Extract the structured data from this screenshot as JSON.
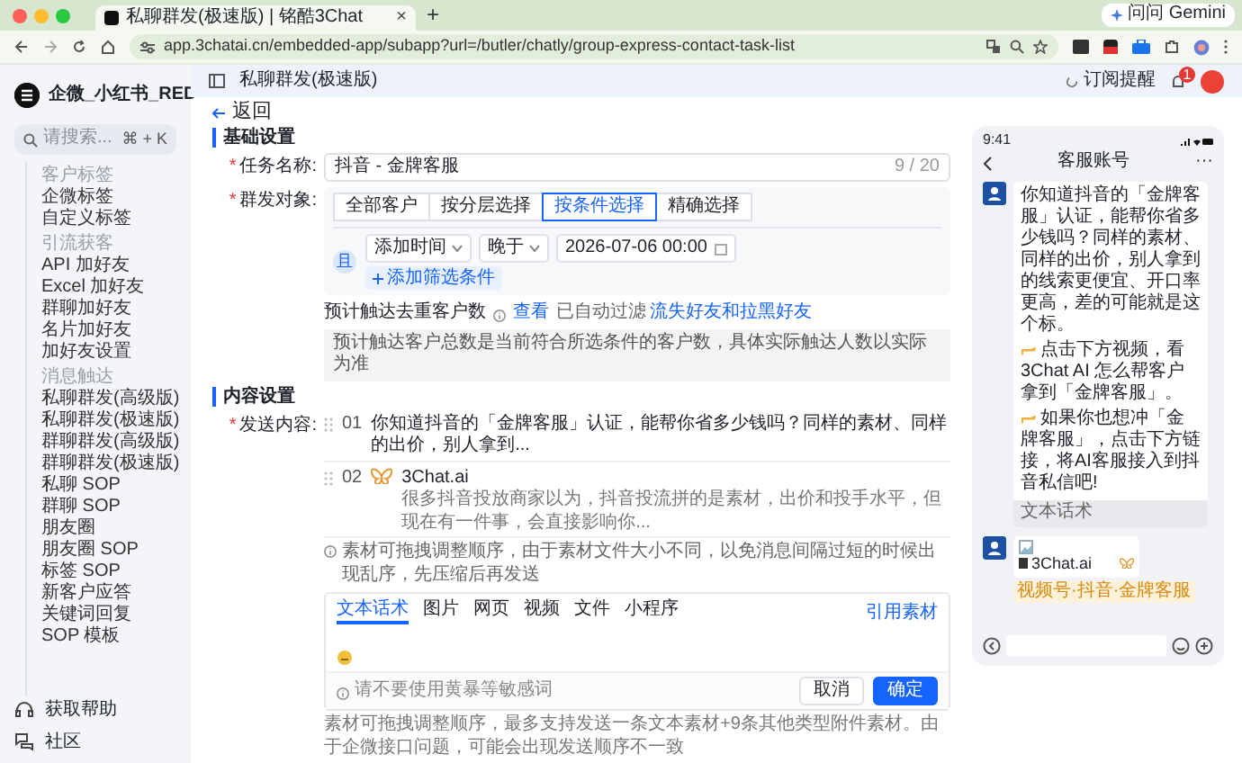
{
  "browser": {
    "tab_title": "私聊群发(极速版) | 铭酷3Chat",
    "tab_close": "×",
    "new_tab": "+",
    "url": "app.3chatai.cn/embedded-app/subapp?url=/butler/chatly/group-express-contact-task-list",
    "gemini": "问问 Gemini"
  },
  "sidebar": {
    "brand": "企微_小红书_RED",
    "search": {
      "placeholder": "请搜索...",
      "shortcut": "⌘ + K"
    },
    "sections": [
      {
        "title": "客户标签",
        "items": [
          "企微标签",
          "自定义标签"
        ]
      },
      {
        "title": "引流获客",
        "items": [
          "API 加好友",
          "Excel 加好友",
          "群聊加好友",
          "名片加好友",
          "加好友设置"
        ]
      },
      {
        "title": "消息触达",
        "items": [
          "私聊群发(高级版)",
          "私聊群发(极速版)",
          "群聊群发(高级版)",
          "群聊群发(极速版)",
          "私聊 SOP",
          "群聊 SOP",
          "朋友圈",
          "朋友圈 SOP",
          "标签 SOP",
          "新客户应答",
          "关键词回复",
          "SOP 模板"
        ]
      }
    ],
    "footer": [
      {
        "kind": "help",
        "label": "获取帮助"
      },
      {
        "kind": "community",
        "label": "社区"
      }
    ]
  },
  "topbar": {
    "title": "私聊群发(极速版)",
    "subscribe": "订阅提醒",
    "notification_count": "1"
  },
  "back": "返回",
  "basic": {
    "title": "基础设置",
    "task_name": {
      "required_mark": "*",
      "label": "任务名称:",
      "value": "抖音 - 金牌客服",
      "counter": "9 / 20"
    },
    "audience": {
      "required_mark": "*",
      "label": "群发对象:",
      "tabs": [
        {
          "label": "全部客户",
          "selected": false
        },
        {
          "label": "按分层选择",
          "selected": false
        },
        {
          "label": "按条件选择",
          "selected": true
        },
        {
          "label": "精确选择",
          "selected": false
        }
      ],
      "logic": "且",
      "conditions": [
        {
          "field": "添加时间",
          "operator": "晚于",
          "value": "2026-07-06 00:00"
        }
      ],
      "add_filter": "添加筛选条件"
    },
    "estimate": {
      "label": "预计触达去重客户数",
      "link": "查看",
      "note_prefix": "已自动过滤",
      "note_highlight": "流失好友和拉黑好友"
    },
    "info": "预计触达客户总数是当前符合所选条件的客户数，具体实际触达人数以实际为准"
  },
  "content": {
    "title": "内容设置",
    "required_mark": "*",
    "label": "发送内容:",
    "items": [
      {
        "kind": "text",
        "index": "01",
        "text": "你知道抖音的「金牌客服」认证，能帮你省多少钱吗？同样的素材、同样的出价，别人拿到..."
      },
      {
        "kind": "link",
        "index": "02",
        "title": "3Chat.ai",
        "description": "很多抖音投放商家以为，抖音投流拼的是素材，出价和投手水平，但现在有一件事，会直接影响你..."
      }
    ],
    "hint": "素材可拖拽调整顺序，由于素材文件大小不同，以免消息间隔过短的时候出现乱序，先压缩后再发送",
    "editor": {
      "tabs": [
        {
          "label": "文本话术",
          "selected": true
        },
        {
          "label": "图片",
          "selected": false
        },
        {
          "label": "网页",
          "selected": false
        },
        {
          "label": "视频",
          "selected": false
        },
        {
          "label": "文件",
          "selected": false
        },
        {
          "label": "小程序",
          "selected": false
        }
      ],
      "quote": "引用素材",
      "warning": "请不要使用黄暴等敏感词",
      "cancel": "取消",
      "confirm": "确定"
    },
    "note": "素材可拖拽调整顺序，最多支持发送一条文本素材+9条其他类型附件素材。由于企微接口问题，可能会出现发送顺序不一致"
  },
  "preview": {
    "time": "9:41",
    "title": "客服账号",
    "more": "···",
    "messages": [
      {
        "kind": "text",
        "paragraphs": [
          {
            "kind": "plain",
            "text": "你知道抖音的「金牌客服」认证，能帮你省多少钱吗？同样的素材、同样的出价，别人拿到的线索更便宜、开口率更高，差的可能就是这个标。"
          },
          {
            "kind": "pointer",
            "text": "点击下方视频，看 3Chat AI 怎么帮客户拿到「金牌客服」。"
          },
          {
            "kind": "pointer",
            "text": "如果你也想冲「金牌客服」，点击下方链接，将AI客服接入到抖音私信吧!"
          }
        ],
        "label": "文本话术"
      },
      {
        "kind": "link",
        "title": "3Chat.ai",
        "tag": "视频号·抖音·金牌客服"
      }
    ]
  }
}
